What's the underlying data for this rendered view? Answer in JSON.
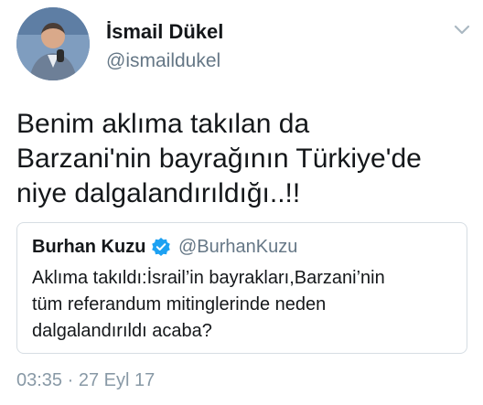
{
  "author": {
    "name": "İsmail Dükel",
    "handle": "@ismaildukel",
    "avatar_icon": "profile-photo"
  },
  "menu": {
    "icon": "chevron-down-icon"
  },
  "tweet": {
    "text": "Benim aklıma takılan da\nBarzani'nin bayrağının Türkiye'de\nniye dalgalandırıldığı..!!"
  },
  "quoted_tweet": {
    "name": "Burhan Kuzu",
    "verified_icon": "verified-badge-icon",
    "handle": "@BurhanKuzu",
    "text": "Aklıma takıldı:İsrail’in bayrakları,Barzani’nin\ntüm referandum mitinglerinde neden\ndalgalandırıldı acaba?"
  },
  "timestamp": "03:35 · 27 Eyl 17",
  "colors": {
    "text": "#14171a",
    "secondary": "#657786",
    "timestamp": "#8899a6",
    "verified": "#1da1f2",
    "border": "#d6dde3"
  }
}
